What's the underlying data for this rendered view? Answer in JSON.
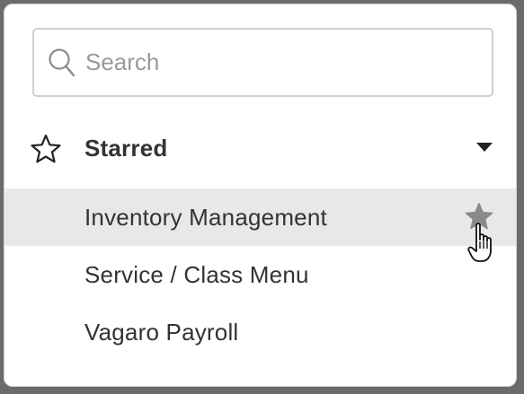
{
  "search": {
    "placeholder": "Search",
    "value": ""
  },
  "starred_section": {
    "label": "Starred",
    "expanded": true
  },
  "items": [
    {
      "label": "Inventory Management",
      "starred": true,
      "hovered": true
    },
    {
      "label": "Service / Class Menu",
      "starred": true,
      "hovered": false
    },
    {
      "label": "Vagaro Payroll",
      "starred": true,
      "hovered": false
    }
  ],
  "colors": {
    "hover_background": "#e8e8e8",
    "text": "#333333",
    "star_fill": "#8a8a8a",
    "border": "#cfcfcf"
  },
  "icons": {
    "search": "search-icon",
    "section": "star-outline-icon",
    "toggle": "caret-down-icon",
    "item_action": "star-filled-icon",
    "cursor": "hand-pointer-icon"
  }
}
